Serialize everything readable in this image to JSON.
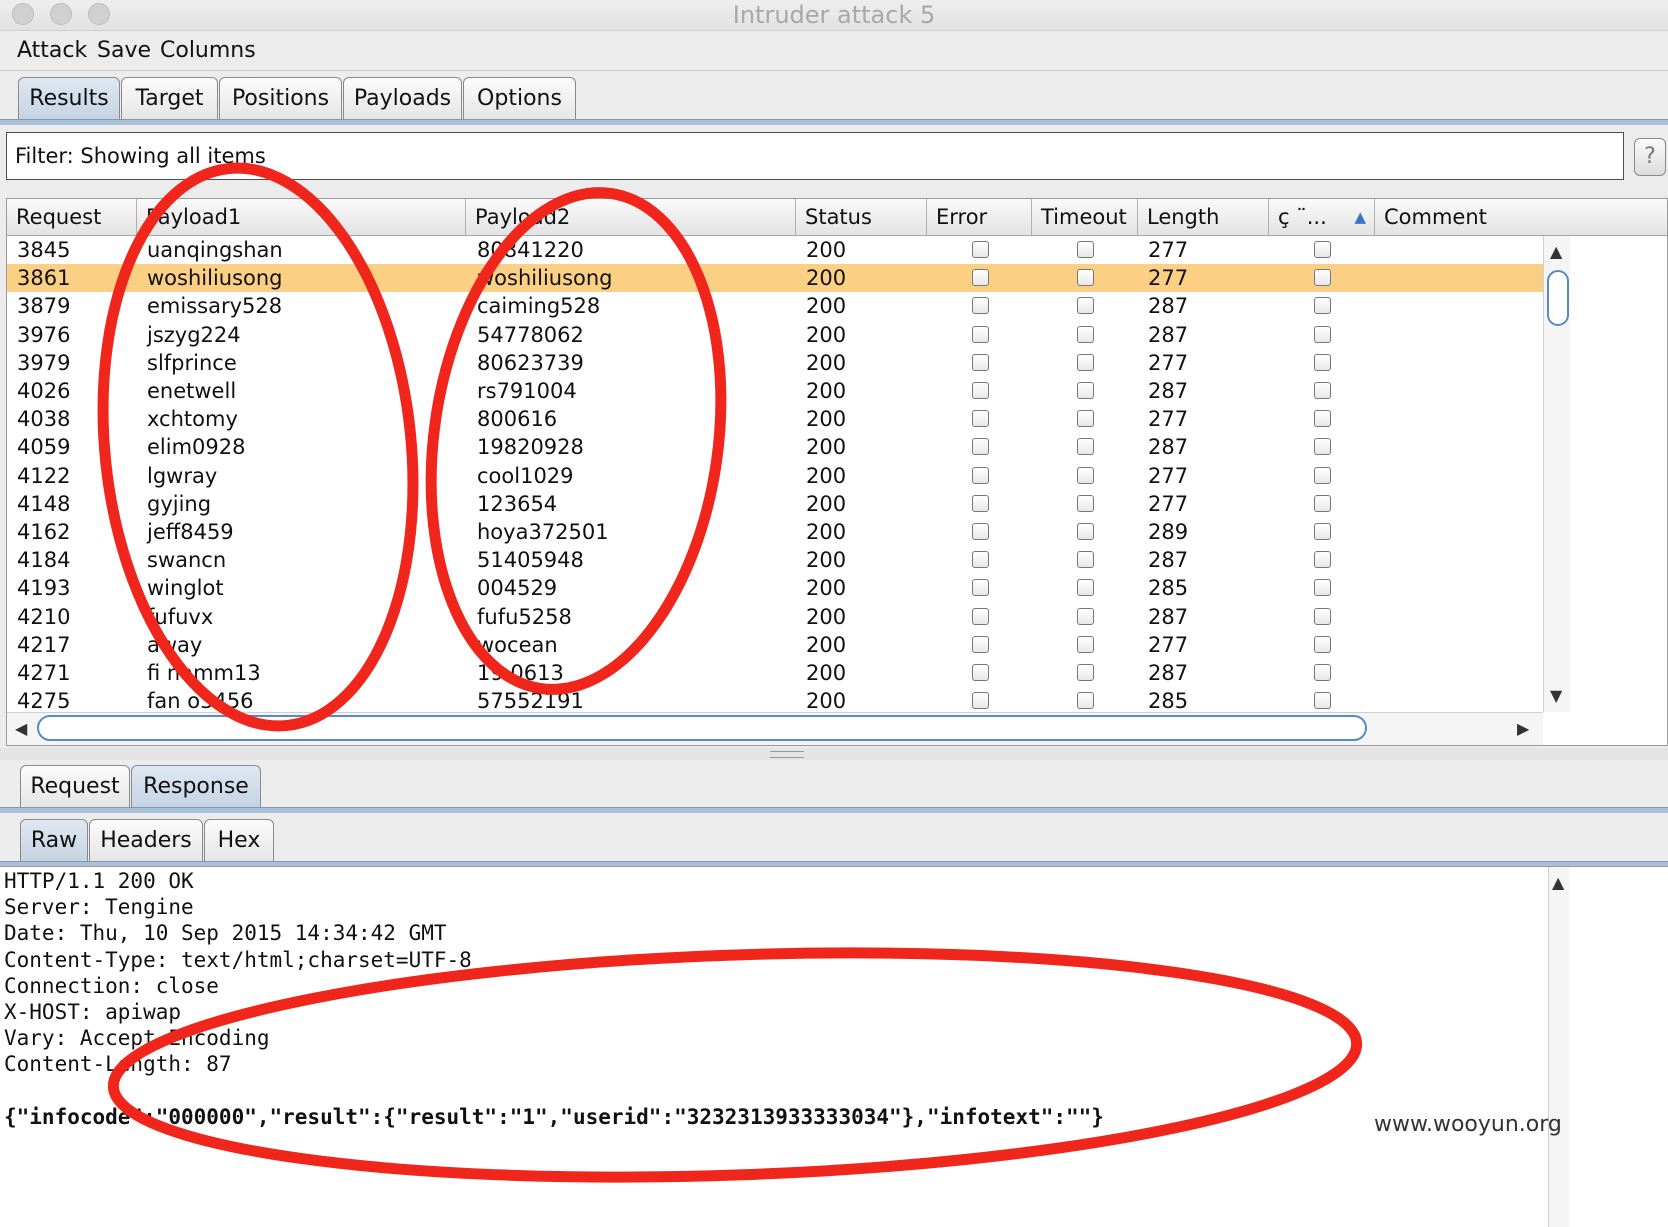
{
  "window": {
    "title": "Intruder attack 5"
  },
  "menu": [
    "Attack",
    "Save",
    "Columns"
  ],
  "main_tabs": [
    {
      "label": "Results",
      "active": true
    },
    {
      "label": "Target",
      "active": false
    },
    {
      "label": "Positions",
      "active": false
    },
    {
      "label": "Payloads",
      "active": false
    },
    {
      "label": "Options",
      "active": false
    }
  ],
  "filter": {
    "text": "Filter: Showing all items",
    "help": "?"
  },
  "table": {
    "columns": [
      "Request",
      "Payload1",
      "Payload2",
      "Status",
      "Error",
      "Timeout",
      "Length",
      "ç ¨...",
      "Comment"
    ],
    "sort_indicator": "▲",
    "selected_request": "3861",
    "rows": [
      {
        "request": "3845",
        "payload1": "uanqingshan",
        "payload2": "80841220",
        "status": "200",
        "length": "277"
      },
      {
        "request": "3861",
        "payload1": "woshiliusong",
        "payload2": "woshiliusong",
        "status": "200",
        "length": "277"
      },
      {
        "request": "3879",
        "payload1": "emissary528",
        "payload2": "caiming528",
        "status": "200",
        "length": "287"
      },
      {
        "request": "3976",
        "payload1": "jszyg224",
        "payload2": "54778062",
        "status": "200",
        "length": "287"
      },
      {
        "request": "3979",
        "payload1": "slfprince",
        "payload2": "80623739",
        "status": "200",
        "length": "277"
      },
      {
        "request": "4026",
        "payload1": "enetwell",
        "payload2": "rs791004",
        "status": "200",
        "length": "287"
      },
      {
        "request": "4038",
        "payload1": "xchtomy",
        "payload2": "800616",
        "status": "200",
        "length": "277"
      },
      {
        "request": "4059",
        "payload1": "elim0928",
        "payload2": "19820928",
        "status": "200",
        "length": "287"
      },
      {
        "request": "4122",
        "payload1": "lgwray",
        "payload2": "cool1029",
        "status": "200",
        "length": "277"
      },
      {
        "request": "4148",
        "payload1": "gyjing",
        "payload2": "123654",
        "status": "200",
        "length": "277"
      },
      {
        "request": "4162",
        "payload1": "jeff8459",
        "payload2": "hoya372501",
        "status": "200",
        "length": "289"
      },
      {
        "request": "4184",
        "payload1": "swancn",
        "payload2": "51405948",
        "status": "200",
        "length": "287"
      },
      {
        "request": "4193",
        "payload1": "winglot",
        "payload2": "004529",
        "status": "200",
        "length": "285"
      },
      {
        "request": "4210",
        "payload1": "fufuvx",
        "payload2": "fufu5258",
        "status": "200",
        "length": "287"
      },
      {
        "request": "4217",
        "payload1": "away",
        "payload2": "wocean",
        "status": "200",
        "length": "277"
      },
      {
        "request": "4271",
        "payload1": "fi  namm13",
        "payload2": "19  0613",
        "status": "200",
        "length": "287"
      },
      {
        "request": "4275",
        "payload1": "fan  o3456",
        "payload2": "57552191",
        "status": "200",
        "length": "285"
      }
    ]
  },
  "detail_tabs": [
    {
      "label": "Request",
      "active": false
    },
    {
      "label": "Response",
      "active": true
    }
  ],
  "view_tabs": [
    {
      "label": "Raw",
      "active": true
    },
    {
      "label": "Headers",
      "active": false
    },
    {
      "label": "Hex",
      "active": false
    }
  ],
  "response": {
    "lines": [
      "HTTP/1.1 200 OK",
      "Server: Tengine",
      "Date: Thu, 10 Sep 2015 14:34:42 GMT",
      "Content-Type: text/html;charset=UTF-8",
      "Connection: close",
      "X-HOST: apiwap",
      "Vary: Accept-Encoding",
      "Content-Length: 87",
      "",
      "{\"infocode\":\"000000\",\"result\":{\"result\":\"1\",\"userid\":\"3232313933333034\"},\"infotext\":\"\"}"
    ]
  },
  "watermark": "www.wooyun.org",
  "annotation_color": "#f0261c"
}
